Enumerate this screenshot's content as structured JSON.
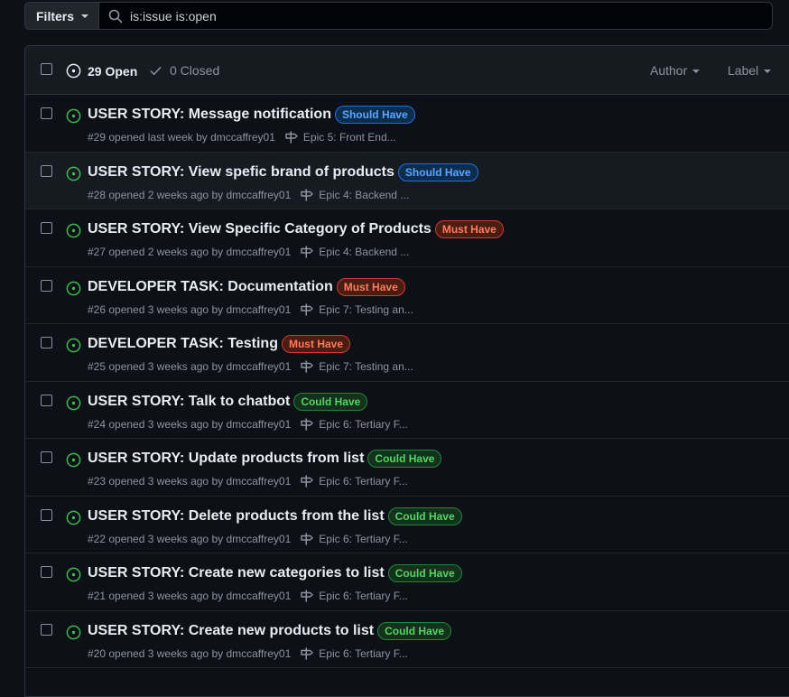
{
  "search": {
    "filters_label": "Filters",
    "query": "is:issue is:open"
  },
  "header": {
    "open_label": "29 Open",
    "closed_label": "0 Closed",
    "author_label": "Author",
    "label_label": "Label"
  },
  "colors": {
    "open_green": "#3fb950",
    "should_have": {
      "text": "#58a6ff",
      "bg": "#0d2d4d",
      "border": "#1f6feb"
    },
    "must_have": {
      "text": "#ff7b5b",
      "bg": "#4a1d13",
      "border": "#da3633"
    },
    "could_have": {
      "text": "#56d364",
      "bg": "#12321b",
      "border": "#238636"
    }
  },
  "issues": [
    {
      "title": "USER STORY: Message notification",
      "label": "Should Have",
      "label_kind": "should_have",
      "meta": "#29 opened last week by dmccaffrey01",
      "milestone": "Epic 5: Front End..."
    },
    {
      "title": "USER STORY: View spefic brand of products",
      "label": "Should Have",
      "label_kind": "should_have",
      "meta": "#28 opened 2 weeks ago by dmccaffrey01",
      "milestone": "Epic 4: Backend ..."
    },
    {
      "title": "USER STORY: View Specific Category of Products",
      "label": "Must Have",
      "label_kind": "must_have",
      "meta": "#27 opened 2 weeks ago by dmccaffrey01",
      "milestone": "Epic 4: Backend ..."
    },
    {
      "title": "DEVELOPER TASK: Documentation",
      "label": "Must Have",
      "label_kind": "must_have",
      "meta": "#26 opened 3 weeks ago by dmccaffrey01",
      "milestone": "Epic 7: Testing an..."
    },
    {
      "title": "DEVELOPER TASK: Testing",
      "label": "Must Have",
      "label_kind": "must_have",
      "meta": "#25 opened 3 weeks ago by dmccaffrey01",
      "milestone": "Epic 7: Testing an..."
    },
    {
      "title": "USER STORY: Talk to chatbot",
      "label": "Could Have",
      "label_kind": "could_have",
      "meta": "#24 opened 3 weeks ago by dmccaffrey01",
      "milestone": "Epic 6: Tertiary F..."
    },
    {
      "title": "USER STORY: Update products from list",
      "label": "Could Have",
      "label_kind": "could_have",
      "meta": "#23 opened 3 weeks ago by dmccaffrey01",
      "milestone": "Epic 6: Tertiary F..."
    },
    {
      "title": "USER STORY: Delete products from the list",
      "label": "Could Have",
      "label_kind": "could_have",
      "meta": "#22 opened 3 weeks ago by dmccaffrey01",
      "milestone": "Epic 6: Tertiary F..."
    },
    {
      "title": "USER STORY: Create new categories to list",
      "label": "Could Have",
      "label_kind": "could_have",
      "meta": "#21 opened 3 weeks ago by dmccaffrey01",
      "milestone": "Epic 6: Tertiary F..."
    },
    {
      "title": "USER STORY: Create new products to list",
      "label": "Could Have",
      "label_kind": "could_have",
      "meta": "#20 opened 3 weeks ago by dmccaffrey01",
      "milestone": "Epic 6: Tertiary F..."
    }
  ]
}
